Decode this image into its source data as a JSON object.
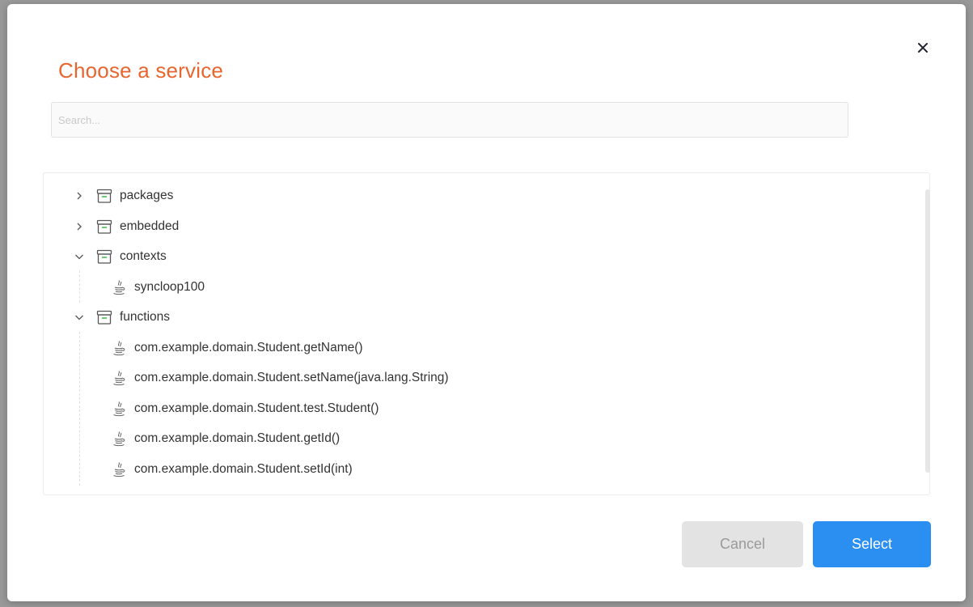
{
  "dialog": {
    "title": "Choose a service",
    "close_icon": "close-icon"
  },
  "search": {
    "placeholder": "Search...",
    "value": ""
  },
  "tree": {
    "nodes": [
      {
        "label": "packages",
        "expanded": false,
        "icon": "archive-icon"
      },
      {
        "label": "embedded",
        "expanded": false,
        "icon": "archive-icon"
      },
      {
        "label": "contexts",
        "expanded": true,
        "icon": "archive-icon",
        "children": [
          {
            "label": "syncloop100",
            "icon": "java-icon"
          }
        ]
      },
      {
        "label": "functions",
        "expanded": true,
        "icon": "archive-icon",
        "children": [
          {
            "label": "com.example.domain.Student.getName()",
            "icon": "java-icon"
          },
          {
            "label": "com.example.domain.Student.setName(java.lang.String)",
            "icon": "java-icon"
          },
          {
            "label": "com.example.domain.Student.test.Student()",
            "icon": "java-icon"
          },
          {
            "label": "com.example.domain.Student.getId()",
            "icon": "java-icon"
          },
          {
            "label": "com.example.domain.Student.setId(int)",
            "icon": "java-icon"
          }
        ]
      }
    ]
  },
  "footer": {
    "cancel_label": "Cancel",
    "select_label": "Select"
  },
  "colors": {
    "title": "#e8652f",
    "primary": "#2a8ff0",
    "folder_accent": "#3cb54a"
  }
}
